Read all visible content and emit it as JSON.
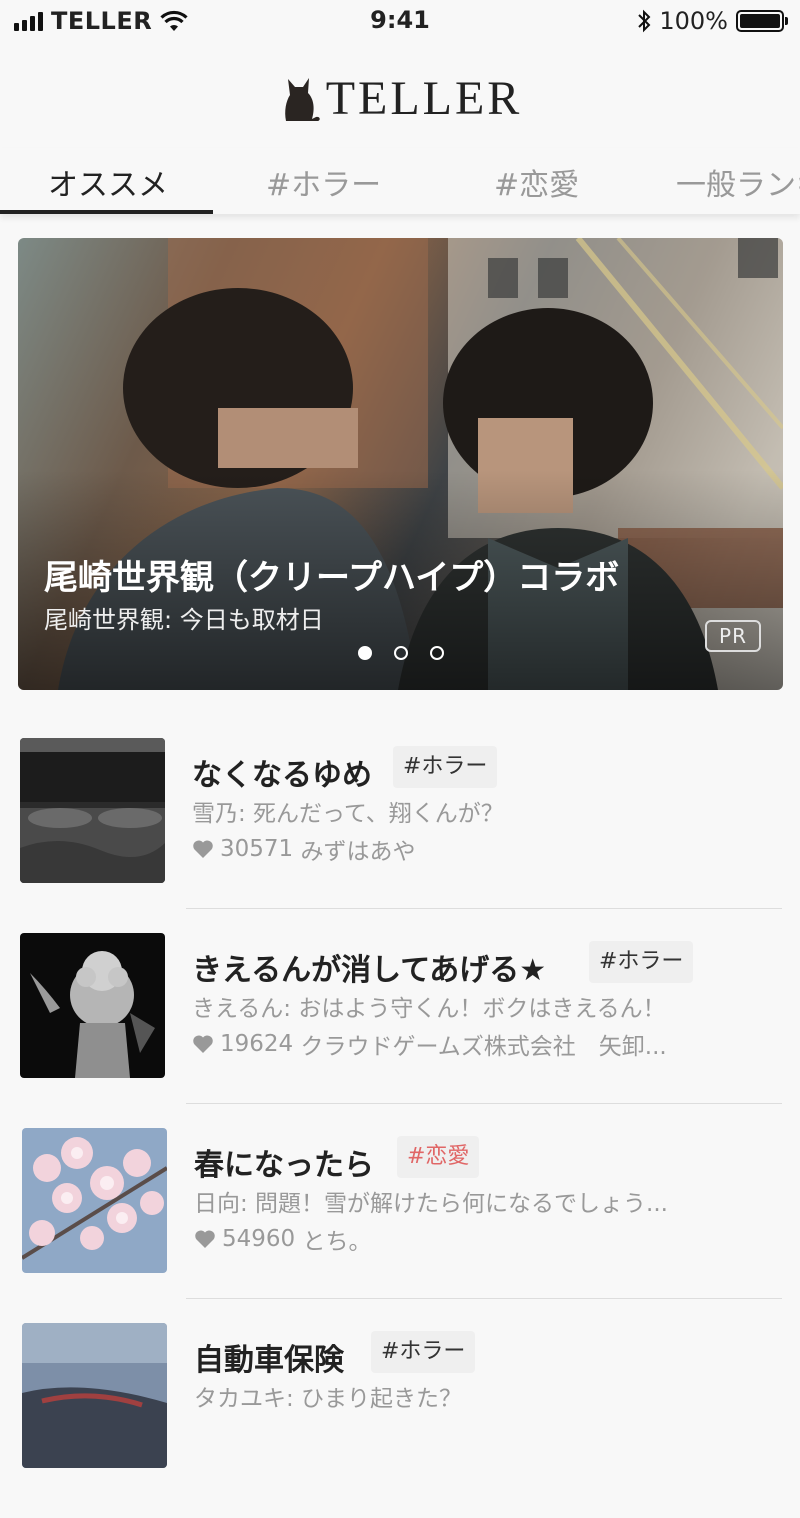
{
  "status_bar": {
    "carrier": "TELLER",
    "time": "9:41",
    "battery": "100%",
    "icons": [
      "signal-icon",
      "wifi-icon",
      "bluetooth-icon",
      "battery-icon"
    ]
  },
  "header": {
    "logo_text": "TELLER",
    "logo_icon": "cat-logo-icon"
  },
  "tabs": [
    {
      "label": "オススメ",
      "active": true
    },
    {
      "label": "#ホラー",
      "active": false
    },
    {
      "label": "#恋愛",
      "active": false
    },
    {
      "label": "一般ランキ",
      "active": false
    }
  ],
  "banner": {
    "title": "尾崎世界観（クリープハイプ）コラボ",
    "subtitle": "尾崎世界観: 今日も取材日",
    "badge": "PR",
    "dots_total": 3,
    "dots_active_index": 0
  },
  "stories": [
    {
      "title": "なくなるゆめ",
      "tag": "#ホラー",
      "tag_type": "horror",
      "line": "雪乃: 死んだって、翔くんが？",
      "likes": "30571",
      "author": "みずはあや",
      "thumb": "bed"
    },
    {
      "title": "きえるんが消してあげる★",
      "tag": "#ホラー",
      "tag_type": "horror",
      "line": "きえるん: おはよう守くん！ボクはきえるん！",
      "likes": "19624",
      "author": "クラウドゲームズ株式会社　矢卸...",
      "thumb": "statue"
    },
    {
      "title": "春になったら",
      "tag": "#恋愛",
      "tag_type": "love",
      "line": "日向: 問題！雪が解けたら何になるでしょう...",
      "likes": "54960",
      "author": "とち。",
      "thumb": "blossom"
    },
    {
      "title": "自動車保険",
      "tag": "#ホラー",
      "tag_type": "horror",
      "line": "タカユキ: ひまり起きた？",
      "likes": "",
      "author": "",
      "thumb": "car"
    }
  ],
  "colors": {
    "love_tag": "#e06666",
    "text_primary": "#222222",
    "text_secondary": "#999999",
    "background": "#f8f8f8"
  }
}
